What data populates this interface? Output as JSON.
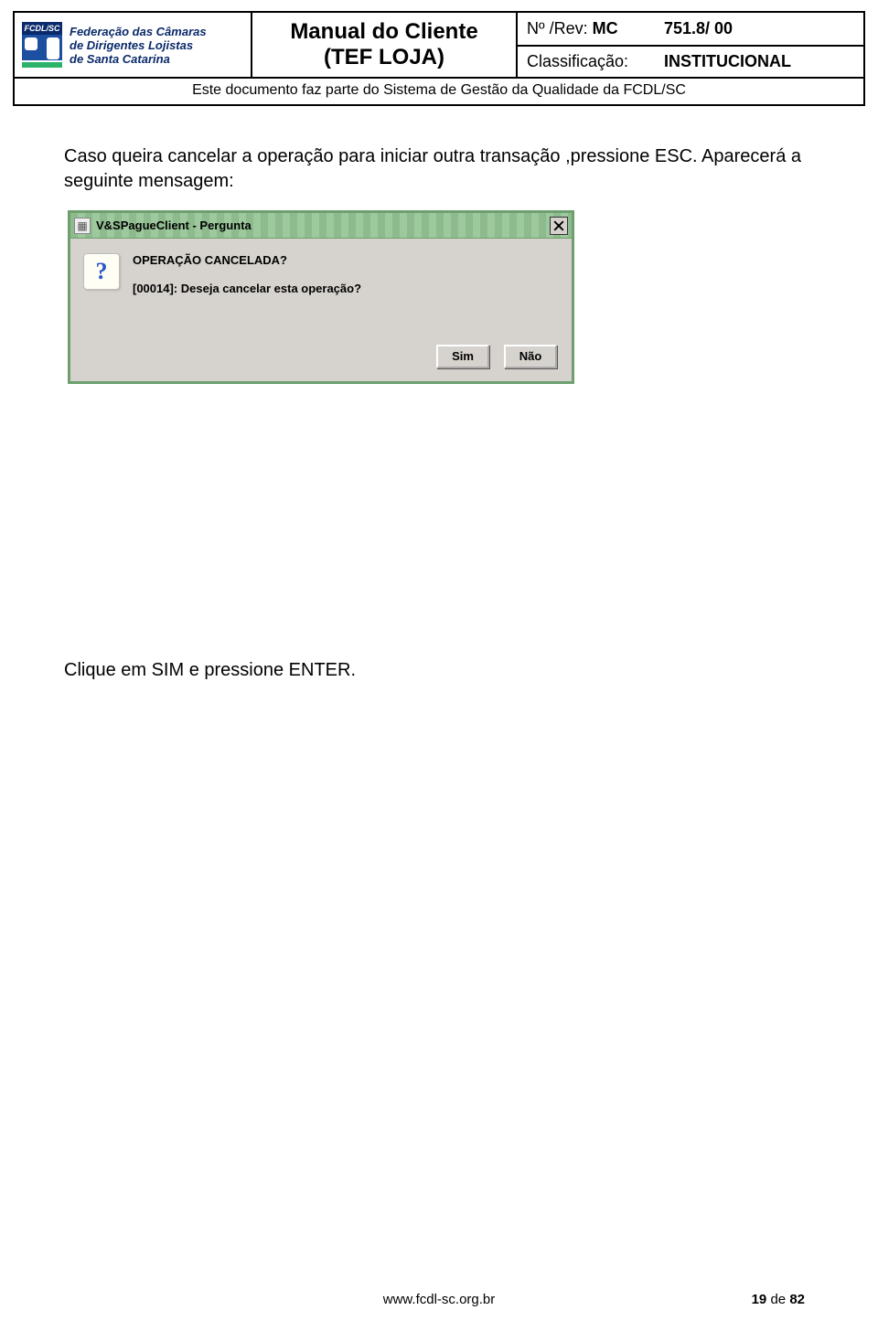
{
  "header": {
    "logo_top": "FCDL/SC",
    "org_line1": "Federação das Câmaras",
    "org_line2": "de Dirigentes Lojistas",
    "org_line3": "de Santa Catarina",
    "title_line1": "Manual do Cliente",
    "title_line2": "(TEF LOJA)",
    "rev_label": "Nº /Rev: ",
    "rev_prefix": "MC",
    "rev_value": "751.8/ 00",
    "class_label": "Classificação:",
    "class_value": "INSTITUCIONAL",
    "subnote": "Este documento faz parte do Sistema de Gestão da Qualidade da FCDL/SC"
  },
  "body": {
    "para1": "Caso queira cancelar a operação para iniciar outra transação ,pressione ESC. Aparecerá a seguinte mensagem:",
    "para2": "Clique em SIM e pressione ENTER."
  },
  "dialog": {
    "title": "V&SPagueClient - Pergunta",
    "icon_glyph": "?",
    "msg1": "OPERAÇÃO CANCELADA?",
    "msg2": "[00014]: Deseja cancelar esta operação?",
    "btn_yes": "Sim",
    "btn_no": "Não"
  },
  "footer": {
    "url": "www.fcdl-sc.org.br",
    "page_current": "19",
    "page_sep": " de ",
    "page_total": "82"
  }
}
